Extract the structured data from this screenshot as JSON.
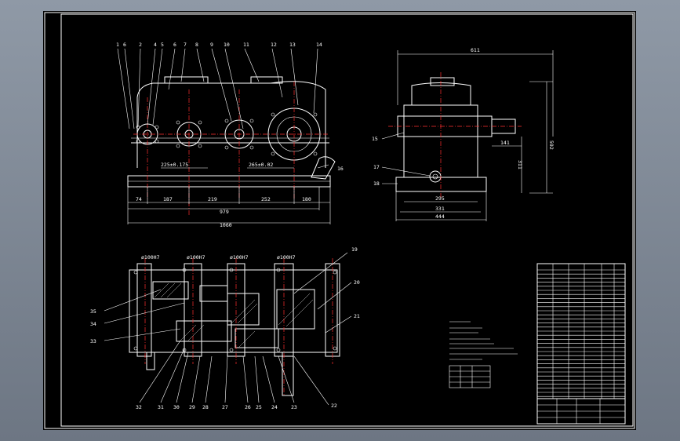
{
  "dims_front": {
    "d74": "74",
    "d187": "187",
    "d219": "219",
    "d252": "252",
    "d180": "180",
    "d979": "979",
    "d1060": "1060",
    "h1": "225±0.175",
    "h2": "265±0.02"
  },
  "dims_side": {
    "w611": "611",
    "h592": "592",
    "h311": "311",
    "d141": "141",
    "d295": "295",
    "d331": "331",
    "d444": "444"
  },
  "balloons_top": [
    "1",
    "6",
    "2",
    "4",
    "5",
    "6",
    "7",
    "8",
    "9",
    "10",
    "11",
    "12",
    "13",
    "14"
  ],
  "balloons_side": [
    "15",
    "17",
    "18",
    "16"
  ],
  "balloons_plan_right": [
    "19",
    "20",
    "21",
    "22"
  ],
  "balloons_plan_bottom": [
    "32",
    "31",
    "30",
    "29",
    "28",
    "27",
    "26",
    "25",
    "24",
    "23"
  ],
  "balloons_plan_left": [
    "35",
    "34",
    "33"
  ],
  "fits_plan": [
    "ø100H7",
    "ø100H7",
    "ø100H7",
    "ø100H7"
  ]
}
